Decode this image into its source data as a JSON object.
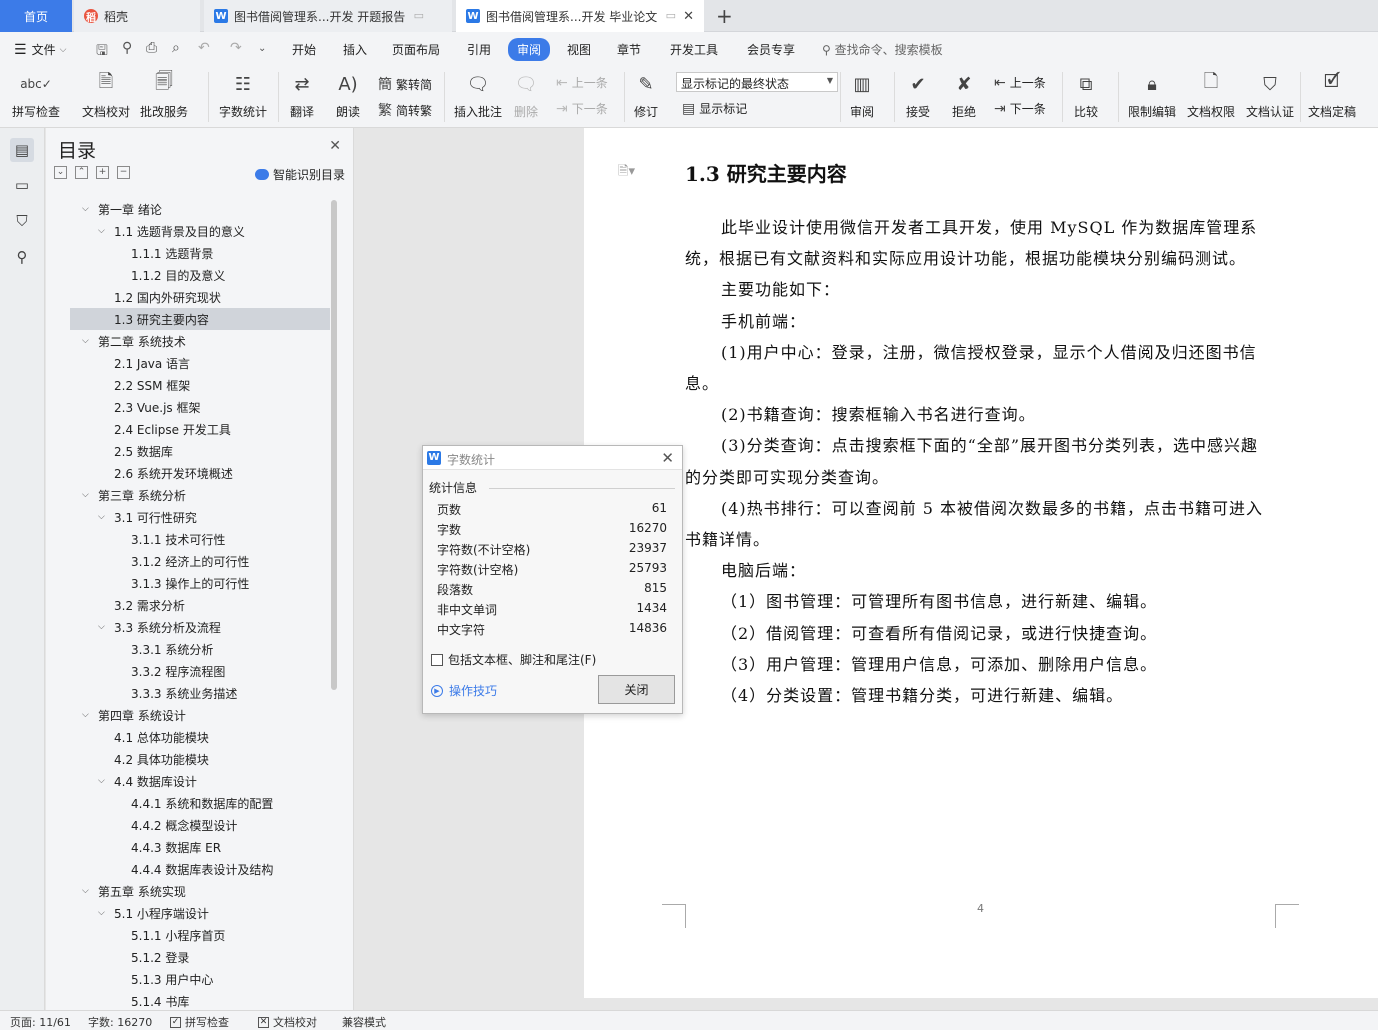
{
  "tabs": {
    "home": "首页",
    "daoke": "稻壳",
    "doc1": "图书借阅管理系...开发 开题报告",
    "doc2": "图书借阅管理系...开发 毕业论文"
  },
  "menu": {
    "file": "文件",
    "items": [
      "开始",
      "插入",
      "页面布局",
      "引用",
      "审阅",
      "视图",
      "章节",
      "开发工具",
      "会员专享"
    ],
    "active": "审阅",
    "search_placeholder": "查找命令、搜索模板"
  },
  "ribbon": {
    "spellcheck": "拼写检查",
    "doc_proof": "文档校对",
    "batch_service": "批改服务",
    "word_count": "字数统计",
    "translate": "翻译",
    "read_aloud": "朗读",
    "trad_to_simp": "繁转简",
    "simp_to_trad": "简转繁",
    "insert_comment": "插入批注",
    "delete": "删除",
    "prev_comment": "上一条",
    "next_comment": "下一条",
    "track_changes": "修订",
    "markup_state": "显示标记的最终状态",
    "show_markup": "显示标记",
    "review_pane": "审阅",
    "accept": "接受",
    "reject": "拒绝",
    "prev_change": "上一条",
    "next_change": "下一条",
    "compare": "比较",
    "restrict_editing": "限制编辑",
    "doc_permissions": "文档权限",
    "doc_certify": "文档认证",
    "doc_finalize": "文档定稿"
  },
  "toc": {
    "title": "目录",
    "smart_toc": "智能识别目录",
    "items": [
      {
        "text": "第一章  绪论",
        "level": 0,
        "chev": "down"
      },
      {
        "text": "1.1 选题背景及目的意义",
        "level": 1,
        "chev": "down"
      },
      {
        "text": "1.1.1 选题背景",
        "level": 2
      },
      {
        "text": "1.1.2 目的及意义",
        "level": 2
      },
      {
        "text": "1.2  国内外研究现状",
        "level": 1
      },
      {
        "text": "1.3 研究主要内容",
        "level": 1,
        "selected": true
      },
      {
        "text": "第二章  系统技术",
        "level": 0,
        "chev": "down"
      },
      {
        "text": "2.1 Java 语言",
        "level": 1
      },
      {
        "text": "2.2 SSM 框架",
        "level": 1
      },
      {
        "text": "2.3 Vue.js 框架",
        "level": 1
      },
      {
        "text": "2.4 Eclipse  开发工具",
        "level": 1
      },
      {
        "text": "2.5 数据库",
        "level": 1
      },
      {
        "text": "2.6 系统开发环境概述",
        "level": 1
      },
      {
        "text": "第三章  系统分析",
        "level": 0,
        "chev": "down"
      },
      {
        "text": "3.1  可行性研究",
        "level": 1,
        "chev": "down"
      },
      {
        "text": "3.1.1  技术可行性",
        "level": 2
      },
      {
        "text": "3.1.2  经济上的可行性",
        "level": 2
      },
      {
        "text": "3.1.3  操作上的可行性",
        "level": 2
      },
      {
        "text": "3.2  需求分析",
        "level": 1
      },
      {
        "text": "3.3  系统分析及流程",
        "level": 1,
        "chev": "down"
      },
      {
        "text": "3.3.1 系统分析",
        "level": 2
      },
      {
        "text": "3.3.2 程序流程图",
        "level": 2
      },
      {
        "text": "3.3.3 系统业务描述",
        "level": 2
      },
      {
        "text": "第四章  系统设计",
        "level": 0,
        "chev": "down"
      },
      {
        "text": "4.1  总体功能模块",
        "level": 1
      },
      {
        "text": "4.2  具体功能模块",
        "level": 1
      },
      {
        "text": "4.4  数据库设计",
        "level": 1,
        "chev": "down"
      },
      {
        "text": "4.4.1 系统和数据库的配置",
        "level": 2
      },
      {
        "text": "4.4.2 概念模型设计",
        "level": 2
      },
      {
        "text": "4.4.3 数据库 ER",
        "level": 2
      },
      {
        "text": "4.4.4 数据库表设计及结构",
        "level": 2
      },
      {
        "text": "第五章  系统实现",
        "level": 0,
        "chev": "down"
      },
      {
        "text": "5.1 小程序端设计",
        "level": 1,
        "chev": "down"
      },
      {
        "text": "5.1.1 小程序首页",
        "level": 2
      },
      {
        "text": "5.1.2 登录",
        "level": 2
      },
      {
        "text": "5.1.3 用户中心",
        "level": 2
      },
      {
        "text": "5.1.4 书库",
        "level": 2
      }
    ]
  },
  "document": {
    "heading": "1.3 研究主要内容",
    "lines": [
      {
        "text": "此毕业设计使用微信开发者工具开发，使用 MySQL 作为数据库管理系",
        "indent": true
      },
      {
        "text": "统，根据已有文献资料和实际应用设计功能，根据功能模块分别编码测试。",
        "indent": false
      },
      {
        "text": "主要功能如下：",
        "indent": true
      },
      {
        "text": "手机前端：",
        "indent": true
      },
      {
        "text": "(1)用户中心：登录，注册，微信授权登录，显示个人借阅及归还图书信",
        "indent": true
      },
      {
        "text": "息。",
        "indent": false
      },
      {
        "text": "(2)书籍查询：搜索框输入书名进行查询。",
        "indent": true
      },
      {
        "text": "(3)分类查询：点击搜索框下面的“全部”展开图书分类列表，选中感兴趣",
        "indent": true
      },
      {
        "text": "的分类即可实现分类查询。",
        "indent": false
      },
      {
        "text": "(4)热书排行：可以查阅前 5 本被借阅次数最多的书籍，点击书籍可进入",
        "indent": true
      },
      {
        "text": "书籍详情。",
        "indent": false
      },
      {
        "text": "电脑后端：",
        "indent": true
      },
      {
        "text": "（1）图书管理：可管理所有图书信息，进行新建、编辑。",
        "indent": true
      },
      {
        "text": "（2）借阅管理：可查看所有借阅记录，或进行快捷查询。",
        "indent": true
      },
      {
        "text": "（3）用户管理：管理用户信息，可添加、删除用户信息。",
        "indent": true
      },
      {
        "text": "（4）分类设置：管理书籍分类，可进行新建、编辑。",
        "indent": true
      }
    ],
    "page_number": "4"
  },
  "dialog": {
    "title": "字数统计",
    "section": "统计信息",
    "stats": [
      {
        "label": "页数",
        "value": "61"
      },
      {
        "label": "字数",
        "value": "16270"
      },
      {
        "label": "字符数(不计空格)",
        "value": "23937"
      },
      {
        "label": "字符数(计空格)",
        "value": "25793"
      },
      {
        "label": "段落数",
        "value": "815"
      },
      {
        "label": "非中文单词",
        "value": "1434"
      },
      {
        "label": "中文字符",
        "value": "14836"
      }
    ],
    "include_label": "包括文本框、脚注和尾注(F)",
    "include_checked": false,
    "tips": "操作技巧",
    "close": "关闭"
  },
  "status": {
    "page": "页面: 11/61",
    "words": "字数: 16270",
    "spellcheck": "拼写检查",
    "proofread": "文档校对",
    "compat": "兼容模式"
  },
  "colors": {
    "accent": "#3c7be8",
    "wps_icon": "#2b79e6"
  }
}
